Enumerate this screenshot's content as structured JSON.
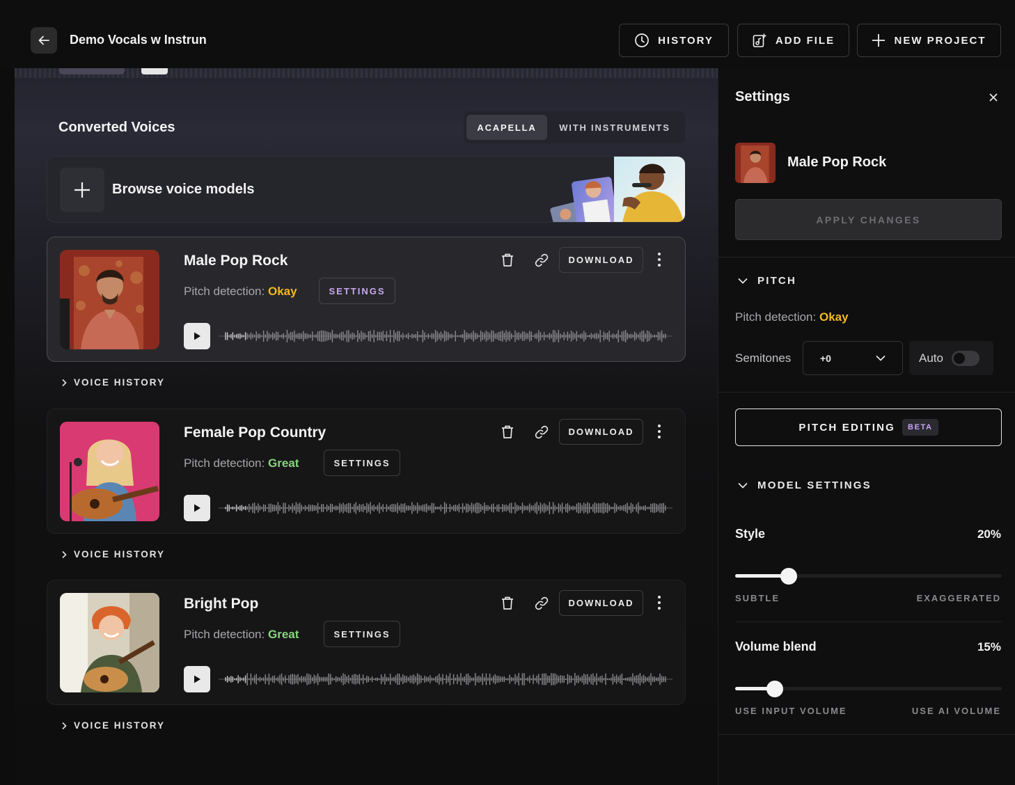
{
  "header": {
    "project_title": "Demo Vocals w Instrun",
    "history_label": "HISTORY",
    "add_file_label": "ADD FILE",
    "new_project_label": "NEW PROJECT"
  },
  "main": {
    "section_title": "Converted Voices",
    "tabs": [
      {
        "label": "ACAPELLA",
        "active": true
      },
      {
        "label": "WITH INSTRUMENTS",
        "active": false
      }
    ],
    "browse_label": "Browse voice models",
    "voice_history_label": "VOICE HISTORY",
    "cards": [
      {
        "title": "Male Pop Rock",
        "pitch_label": "Pitch detection:",
        "pitch_value": "Okay",
        "settings_label": "SETTINGS",
        "download_label": "DOWNLOAD",
        "selected": true
      },
      {
        "title": "Female Pop Country",
        "pitch_label": "Pitch detection:",
        "pitch_value": "Great",
        "settings_label": "SETTINGS",
        "download_label": "DOWNLOAD",
        "selected": false
      },
      {
        "title": "Bright Pop",
        "pitch_label": "Pitch detection:",
        "pitch_value": "Great",
        "settings_label": "SETTINGS",
        "download_label": "DOWNLOAD",
        "selected": false
      }
    ]
  },
  "panel": {
    "title": "Settings",
    "voice_name": "Male Pop Rock",
    "apply_label": "APPLY CHANGES",
    "pitch_section": "PITCH",
    "pitch_label": "Pitch detection:",
    "pitch_value": "Okay",
    "semitones_label": "Semitones",
    "semitones_value": "+0",
    "auto_label": "Auto",
    "auto_on": false,
    "pitch_editing_label": "PITCH EDITING",
    "beta_label": "BETA",
    "model_section": "MODEL SETTINGS",
    "style": {
      "label": "Style",
      "value": "20%",
      "fraction": 0.2,
      "min_label": "SUBTLE",
      "max_label": "EXAGGERATED"
    },
    "volume": {
      "label": "Volume blend",
      "value": "15%",
      "fraction": 0.15,
      "min_label": "USE INPUT VOLUME",
      "max_label": "USE AI VOLUME"
    }
  },
  "colors": {
    "okay": "#f6b91b",
    "great": "#86d67d",
    "beta": "#c8a3f5"
  }
}
